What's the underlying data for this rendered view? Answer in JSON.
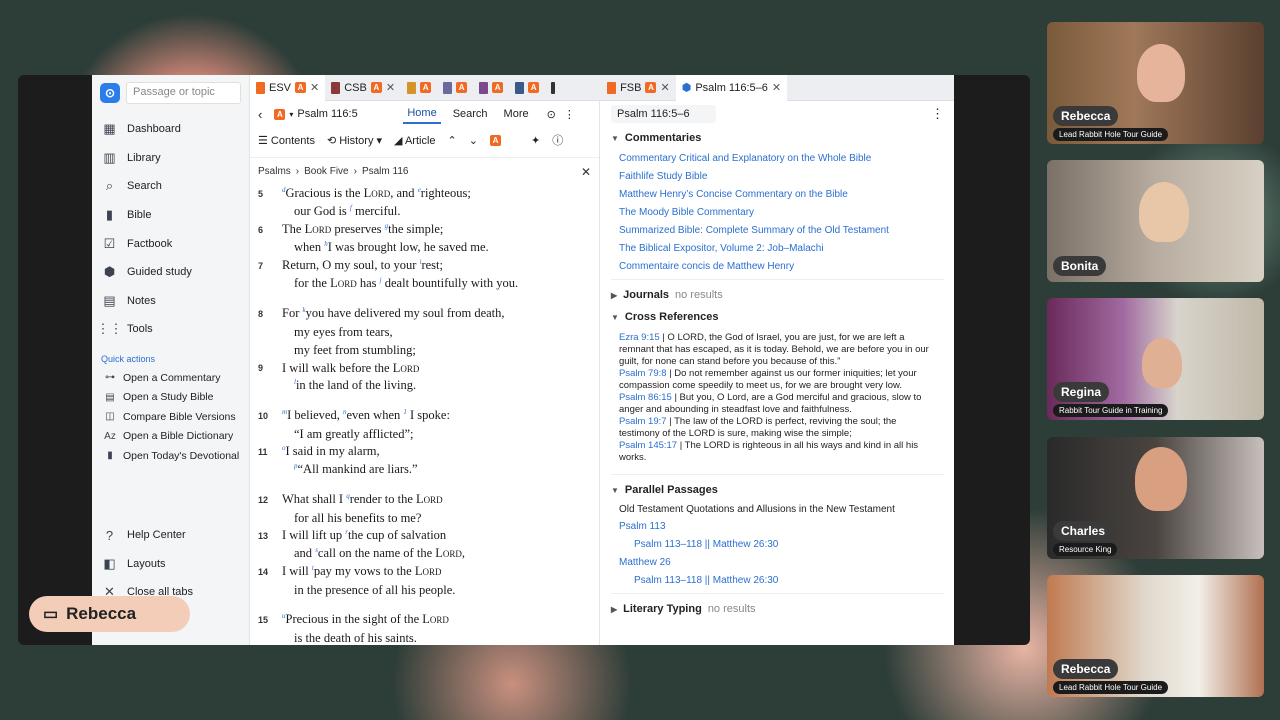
{
  "sidebar": {
    "search_placeholder": "Passage or topic",
    "nav": [
      {
        "label": "Dashboard",
        "icon": "dashboard-icon"
      },
      {
        "label": "Library",
        "icon": "library-icon"
      },
      {
        "label": "Search",
        "icon": "search-icon"
      },
      {
        "label": "Bible",
        "icon": "bible-icon"
      },
      {
        "label": "Factbook",
        "icon": "factbook-icon"
      },
      {
        "label": "Guided study",
        "icon": "guided-study-icon"
      },
      {
        "label": "Notes",
        "icon": "notes-icon"
      },
      {
        "label": "Tools",
        "icon": "tools-icon"
      }
    ],
    "quick_actions_title": "Quick actions",
    "quick_actions": [
      {
        "label": "Open a Commentary"
      },
      {
        "label": "Open a Study Bible"
      },
      {
        "label": "Compare Bible Versions"
      },
      {
        "label": "Open a Bible Dictionary"
      },
      {
        "label": "Open Today's Devotional"
      }
    ],
    "bottom": [
      {
        "label": "Help Center"
      },
      {
        "label": "Layouts"
      },
      {
        "label": "Close all tabs"
      }
    ]
  },
  "tabs": {
    "left": [
      {
        "label": "ESV",
        "active": true
      },
      {
        "label": "CSB",
        "active": false
      }
    ],
    "right": [
      {
        "label": "FSB",
        "active": false
      },
      {
        "label": "Psalm 116:5–6",
        "active": true
      }
    ]
  },
  "left_pane": {
    "reference": "Psalm 116:5",
    "tabs": [
      "Home",
      "Search",
      "More"
    ],
    "toolbar": {
      "contents": "Contents",
      "history": "History",
      "article": "Article"
    },
    "breadcrumb": [
      "Psalms",
      "Book Five",
      "Psalm 116"
    ]
  },
  "bible_text": {
    "v5a_pre": "Gracious is the ",
    "v5a_lord": "Lord",
    "v5a_post": ", and ",
    "v5a_end": "righteous;",
    "v5b_pre": "our God is ",
    "v5b_end": "merciful.",
    "v6a_pre": "The ",
    "v6a_lord": "Lord",
    "v6a_mid": " preserves ",
    "v6a_end": "the simple;",
    "v6b_pre": "when ",
    "v6b_end": "I was brought low, he saved me.",
    "v7a_pre": "Return, O my soul, to your ",
    "v7a_end": "rest;",
    "v7b_pre": "for the ",
    "v7b_lord": "Lord",
    "v7b_mid": " has ",
    "v7b_end": "dealt bountifully with you.",
    "v8a_pre": "For ",
    "v8a_end": "you have delivered my soul from death,",
    "v8b": "my eyes from tears,",
    "v8c": "my feet from stumbling;",
    "v9a_pre": "I will walk before the ",
    "v9a_lord": "Lord",
    "v9b": "in the land of the living.",
    "v10a_end": "I believed, ",
    "v10a_mid": "even when ",
    "v10a_tail": " I spoke:",
    "v10b": "“I am greatly afflicted”;",
    "v11a": "I said in my alarm,",
    "v11b": "“All mankind are liars.”",
    "v12a_pre": "What shall I ",
    "v12a_mid": "render to the ",
    "v12a_lord": "Lord",
    "v12b": "for all his benefits to me?",
    "v13a_pre": "I will lift up ",
    "v13a_end": "the cup of salvation",
    "v13b_pre": "and ",
    "v13b_mid": "call on the name of the ",
    "v13b_lord": "Lord",
    "v14a_pre": "I will ",
    "v14a_mid": "pay my vows to the ",
    "v14a_lord": "Lord",
    "v14b": "in the presence of all his people.",
    "v15a_pre": "Precious in the sight of the ",
    "v15a_lord": "Lord",
    "v15b": "is the death of his saints.",
    "nums": [
      "5",
      "6",
      "7",
      "8",
      "9",
      "10",
      "11",
      "12",
      "13",
      "14",
      "15"
    ]
  },
  "right_pane": {
    "reference": "Psalm 116:5–6",
    "commentaries_title": "Commentaries",
    "commentaries": [
      "Commentary Critical and Explanatory on the Whole Bible",
      "Faithlife Study Bible",
      "Matthew Henry’s Concise Commentary on the Bible",
      "The Moody Bible Commentary",
      "Summarized Bible: Complete Summary of the Old Testament",
      "The Biblical Expositor, Volume 2: Job–Malachi",
      "Commentaire concis de Matthew Henry"
    ],
    "journals_title": "Journals",
    "no_results": "no results",
    "xref_title": "Cross References",
    "xrefs": [
      {
        "ref": "Ezra 9:15",
        "text": " | O LORD, the God of Israel, you are just, for we are left a remnant that has escaped, as it is today. Behold, we are before you in our guilt, for none can stand before you because of this.”"
      },
      {
        "ref": "Psalm 79:8",
        "text": " | Do not remember against us our former iniquities; let your compassion come speedily to meet us, for we are brought very low."
      },
      {
        "ref": "Psalm 86:15",
        "text": " | But you, O Lord, are a God merciful and gracious, slow to anger and abounding in steadfast love and faithfulness."
      },
      {
        "ref": "Psalm 19:7",
        "text": " | The law of the LORD is perfect, reviving the soul; the testimony of the LORD is sure, making wise the simple;"
      },
      {
        "ref": "Psalm 145:17",
        "text": " | The LORD is righteous in all his ways and kind in all his works."
      }
    ],
    "parallel_title": "Parallel Passages",
    "parallel_sub": "Old Testament Quotations and Allusions in the New Testament",
    "parallel": [
      {
        "head": "Psalm 113",
        "item": "Psalm 113–118 || Matthew 26:30"
      },
      {
        "head": "Matthew 26",
        "item": "Psalm 113–118 || Matthew 26:30"
      }
    ],
    "literary_title": "Literary Typing"
  },
  "participants": [
    {
      "name": "Rebecca",
      "role": "Lead Rabbit Hole Tour Guide"
    },
    {
      "name": "Bonita",
      "role": ""
    },
    {
      "name": "Regina",
      "role": "Rabbit Tour Guide in Training"
    },
    {
      "name": "Charles",
      "role": "Resource King"
    },
    {
      "name": "Rebecca",
      "role": "Lead Rabbit Hole Tour Guide"
    }
  ],
  "active_speaker": "Rebecca",
  "colors": {
    "accent": "#2b6fd1",
    "logos_orange": "#f06a24"
  }
}
